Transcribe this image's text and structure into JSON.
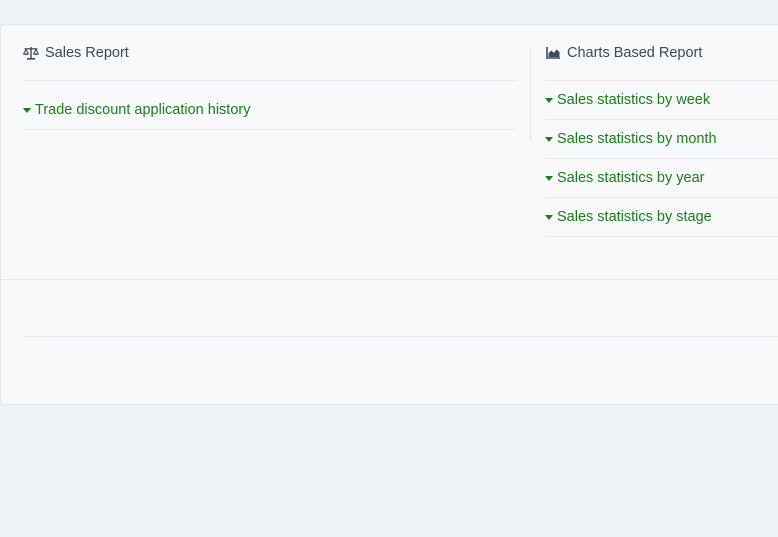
{
  "sales_report": {
    "title": "Sales Report",
    "icon": "scale-icon",
    "links": [
      {
        "label": "Trade discount application history"
      }
    ]
  },
  "charts_report": {
    "title": "Charts Based Report",
    "icon": "area-chart-icon",
    "links": [
      {
        "label": "Sales statistics by week"
      },
      {
        "label": "Sales statistics by month"
      },
      {
        "label": "Sales statistics by year"
      },
      {
        "label": "Sales statistics by stage"
      }
    ]
  },
  "colors": {
    "link": "#1a7f1a",
    "header_text": "#3e4a5a",
    "background": "#eff2f6",
    "card": "#f8f9fb"
  }
}
